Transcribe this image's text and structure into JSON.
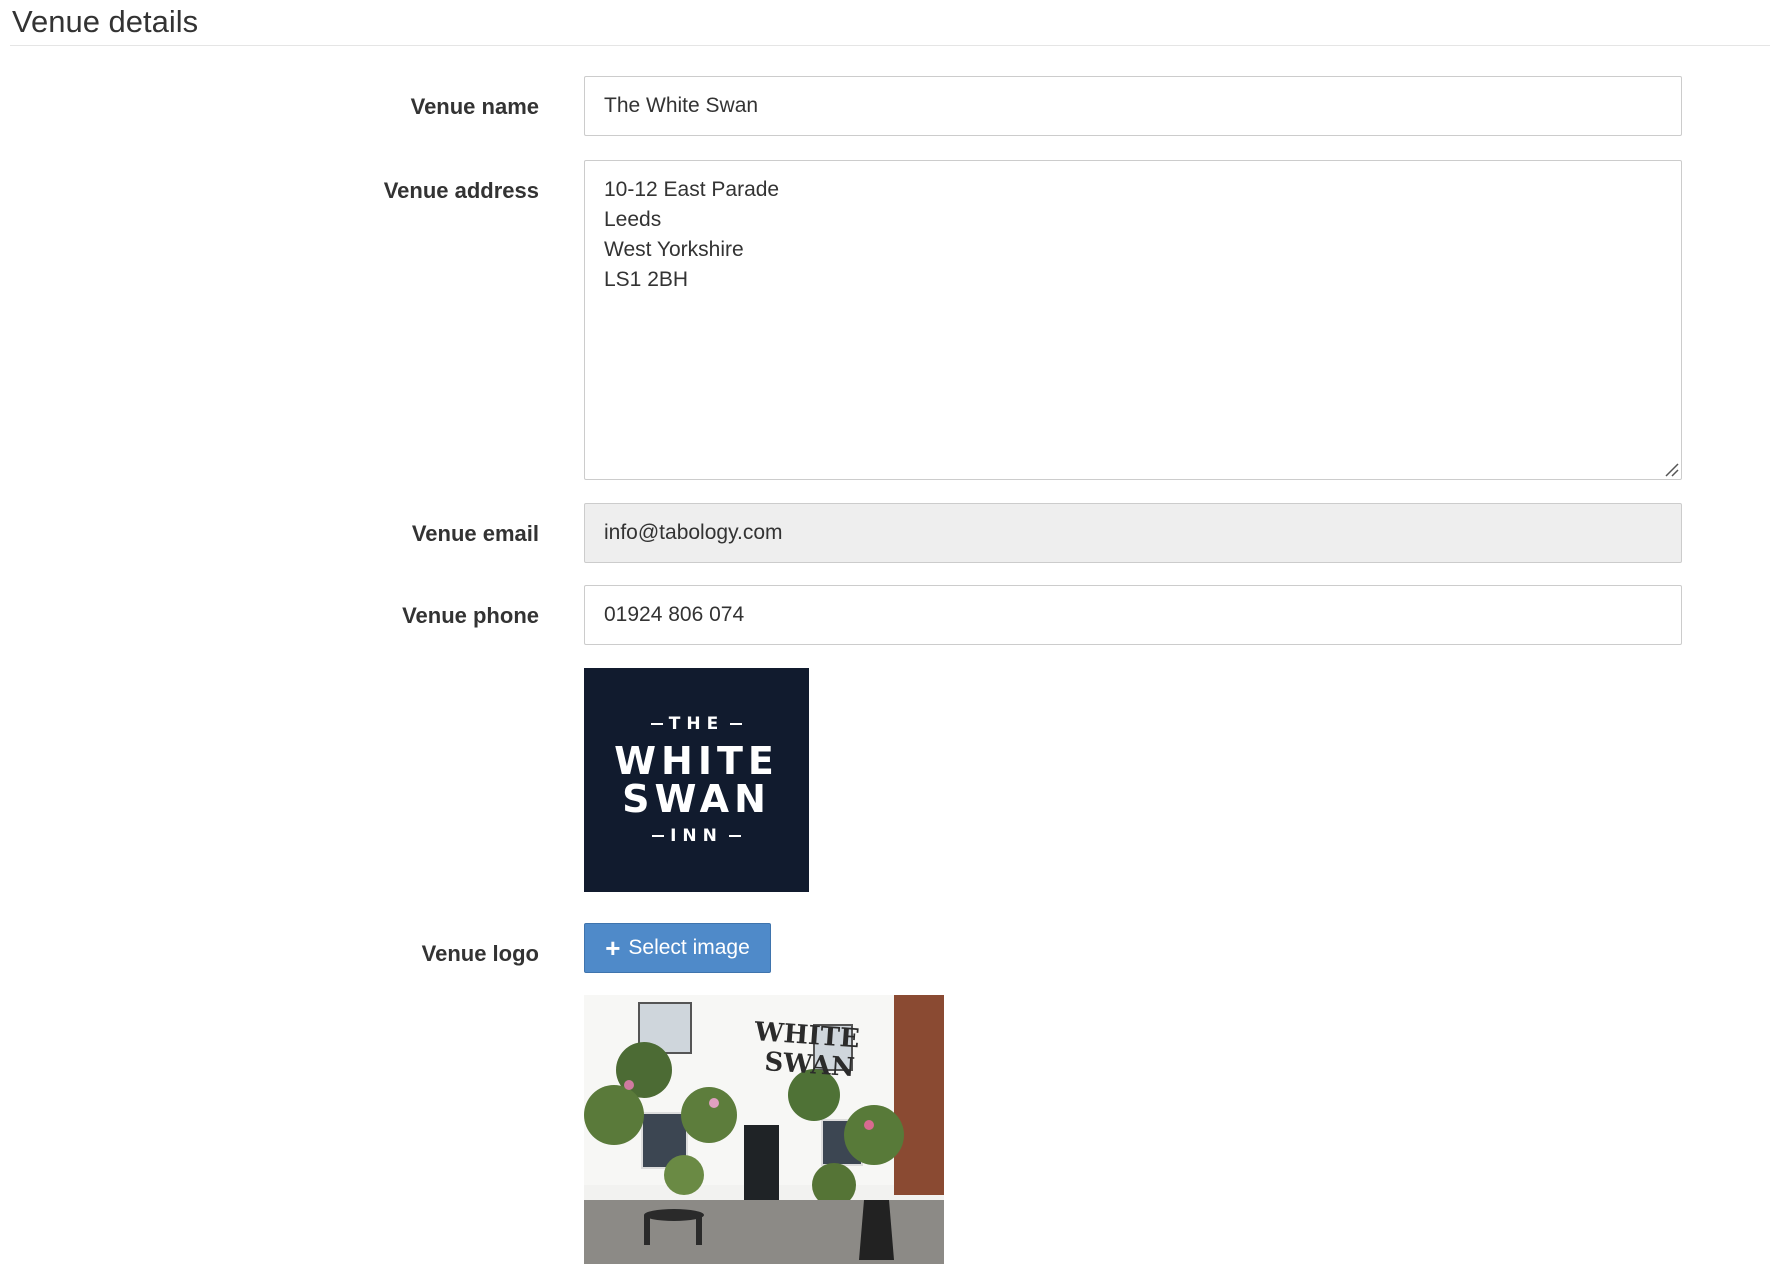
{
  "section": {
    "title": "Venue details"
  },
  "fields": {
    "name": {
      "label": "Venue name",
      "value": "The White Swan"
    },
    "address": {
      "label": "Venue address",
      "lines": [
        "10-12 East Parade",
        "Leeds",
        "West Yorkshire",
        "LS1 2BH"
      ]
    },
    "email": {
      "label": "Venue email",
      "value": "info@tabology.com"
    },
    "phone": {
      "label": "Venue phone",
      "value": "01924 806 074"
    },
    "logo": {
      "label": "Venue logo",
      "button_label": "Select image",
      "button_icon": "plus-icon",
      "logo_text": {
        "top": "THE",
        "line1": "WHITE",
        "line2": "SWAN",
        "bottom": "INN"
      },
      "logo_bg_color": "#111b2e"
    },
    "photo": {
      "sign_text": [
        "WHITE",
        "SWAN"
      ]
    }
  },
  "colors": {
    "primary_button": "#4f8ac9",
    "disabled_input": "#eeeeee",
    "border": "#cccccc"
  }
}
